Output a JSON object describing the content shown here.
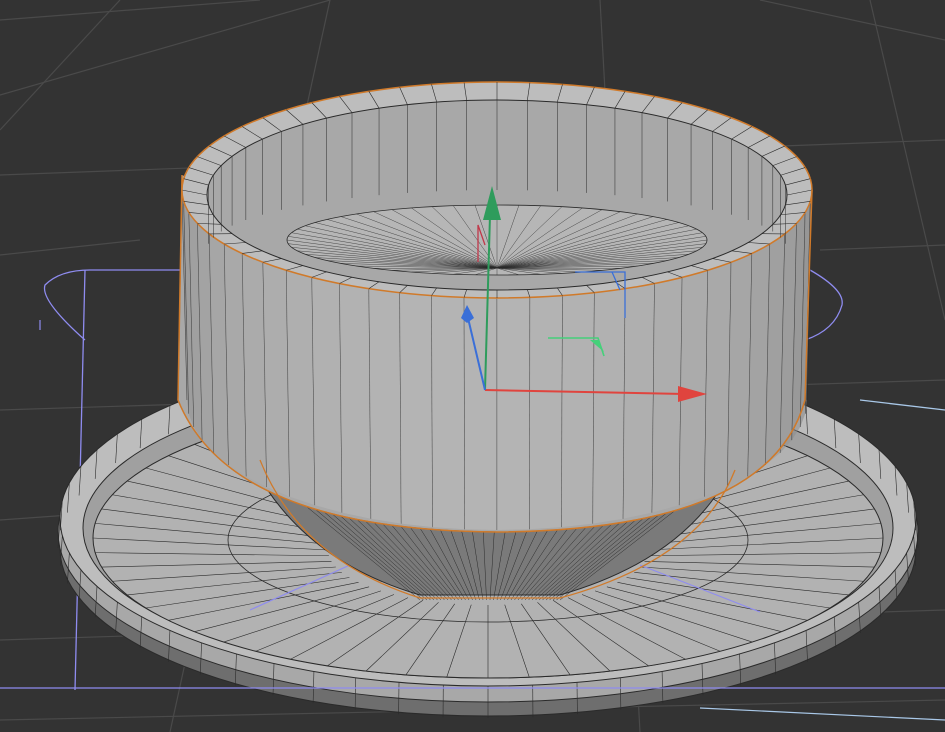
{
  "viewport": {
    "background": "#333333",
    "grid_color": "#4a4a4a",
    "grid_shadow": "#2b2b2b"
  },
  "model": {
    "fill_light": "#bdbdbd",
    "fill_mid": "#a8a8a8",
    "fill_dark": "#7a7a7a",
    "wire_color": "#2a2a2a",
    "selection_outline": "#d07a2a",
    "visible_segments": 60
  },
  "overlay": {
    "lattice_color": "#8f8cf0",
    "lattice_color_2": "#a9c8e8"
  },
  "gizmo": {
    "x_axis_color": "#e0443e",
    "y_axis_color": "#2e9c5c",
    "z_axis_color": "#3a6fd8",
    "plane_xy_color": "#45d07a",
    "plane_yz_color": "#3a6fd8",
    "plane_xz_color": "#c0394a",
    "icons": [
      "move-arrow-x-icon",
      "move-arrow-y-icon",
      "move-arrow-z-icon"
    ]
  }
}
